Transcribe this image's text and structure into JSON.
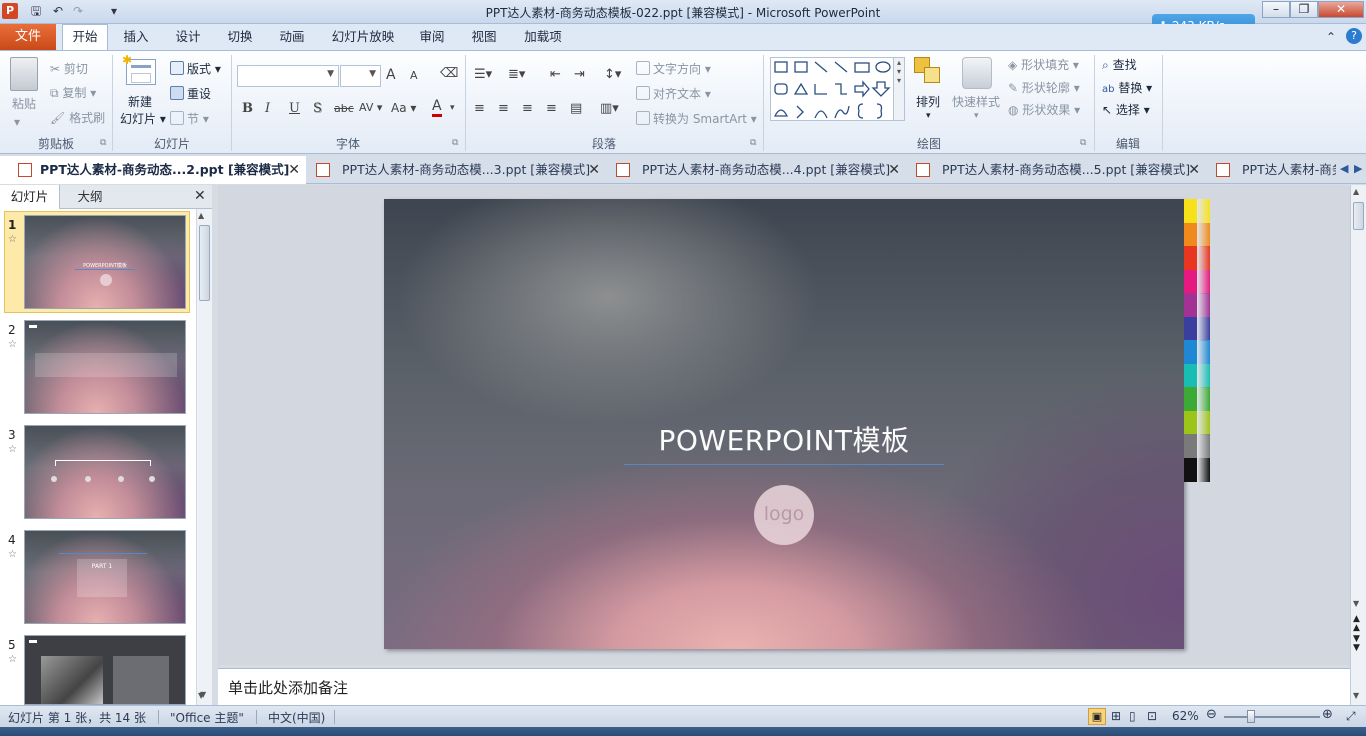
{
  "window": {
    "title": "PPT达人素材-商务动态模板-022.ppt [兼容模式]  -  Microsoft PowerPoint",
    "app_icon": "P",
    "network_speed": "243 KB/s"
  },
  "ribbon_tabs": [
    "文件",
    "开始",
    "插入",
    "设计",
    "切换",
    "动画",
    "幻灯片放映",
    "审阅",
    "视图",
    "加载项"
  ],
  "ribbon": {
    "clipboard": {
      "paste": "粘贴",
      "cut": "剪切",
      "copy": "复制",
      "format_painter": "格式刷",
      "label": "剪贴板"
    },
    "slides": {
      "new_slide_line1": "新建",
      "new_slide_line2": "幻灯片",
      "layout": "版式",
      "reset": "重设",
      "section": "节",
      "label": "幻灯片"
    },
    "font": {
      "label": "字体",
      "bold": "B",
      "italic": "I",
      "underline": "U",
      "shadow": "S",
      "strike": "abc",
      "spacing": "AV",
      "case": "Aa",
      "color": "A",
      "grow": "A",
      "shrink": "A"
    },
    "paragraph": {
      "text_direction": "文字方向",
      "align_text": "对齐文本",
      "smartart": "转换为 SmartArt",
      "label": "段落"
    },
    "drawing": {
      "arrange": "排列",
      "quick_styles": "快速样式",
      "shape_fill": "形状填充",
      "shape_outline": "形状轮廓",
      "shape_effects": "形状效果",
      "label": "绘图"
    },
    "editing": {
      "find": "查找",
      "replace": "替换",
      "select": "选择",
      "label": "编辑"
    }
  },
  "doc_tabs": [
    "PPT达人素材-商务动态...2.ppt [兼容模式]",
    "PPT达人素材-商务动态模...3.ppt [兼容模式]",
    "PPT达人素材-商务动态模...4.ppt [兼容模式]",
    "PPT达人素材-商务动态模...5.ppt [兼容模式]",
    "PPT达人素材-商务"
  ],
  "pane_tabs": {
    "slides": "幻灯片",
    "outline": "大纲"
  },
  "thumbnails": [
    {
      "num": "1",
      "text": "POWERPOINT模板"
    },
    {
      "num": "2",
      "text": ""
    },
    {
      "num": "3",
      "text": ""
    },
    {
      "num": "4",
      "text": "PART 1"
    },
    {
      "num": "5",
      "text": ""
    }
  ],
  "slide": {
    "title": "POWERPOINT模板",
    "logo": "logo"
  },
  "swatch_colors": [
    "#f7e21a",
    "#f08a1c",
    "#e8361f",
    "#e5197f",
    "#a23394",
    "#3a3f9f",
    "#1e88d5",
    "#1abdb2",
    "#3daa35",
    "#9dc419",
    "#7a7a7a",
    "#111111"
  ],
  "notes": {
    "placeholder": "单击此处添加备注"
  },
  "status": {
    "slide_info": "幻灯片 第 1 张，共 14 张",
    "theme": "\"Office 主题\"",
    "language": "中文(中国)",
    "zoom": "62%"
  }
}
